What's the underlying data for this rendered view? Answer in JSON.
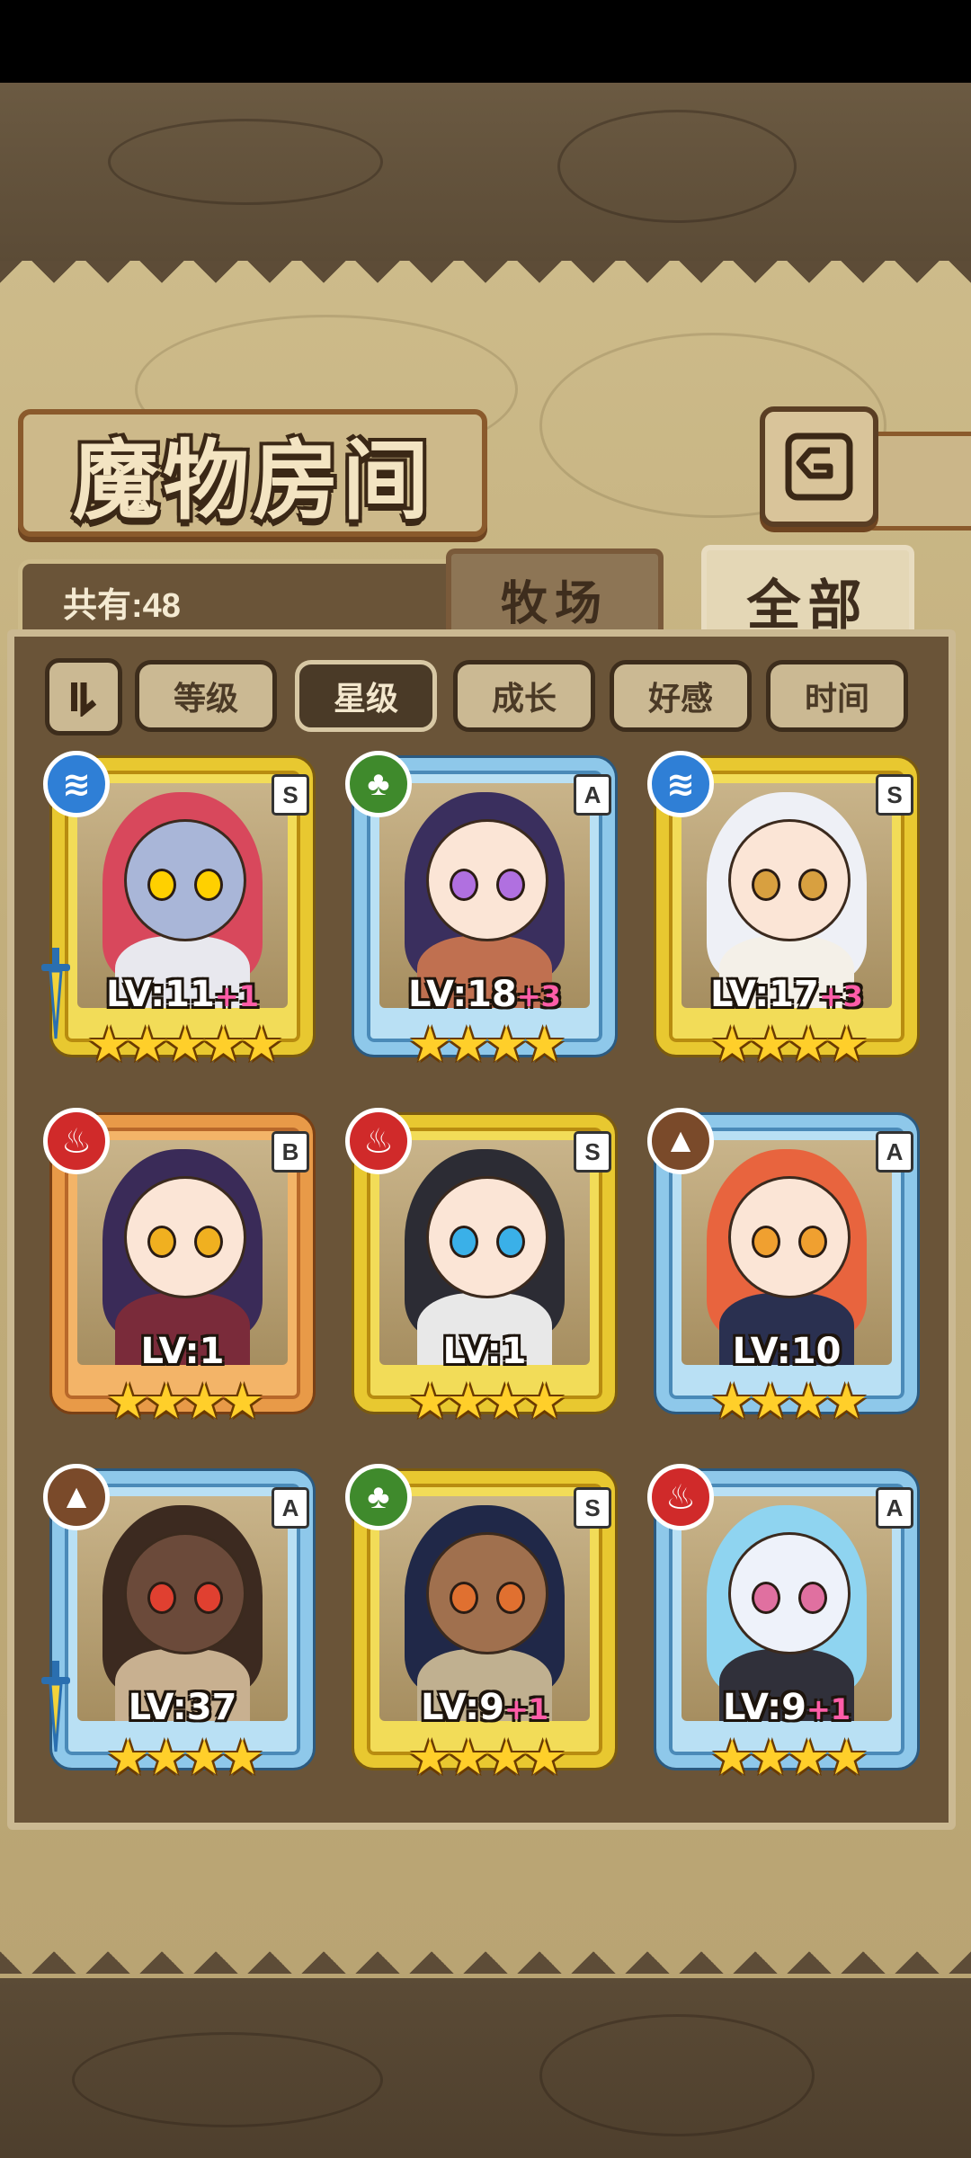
{
  "title": "魔物房间",
  "count_label": "共有:48",
  "tabs": {
    "ranch": "牧场",
    "all": "全部"
  },
  "sort_buttons": [
    "等级",
    "星级",
    "成长",
    "好感",
    "时间"
  ],
  "active_sort": "星级",
  "colors": {
    "element_water": "#2f7fd6",
    "element_wood": "#3f8a2c",
    "element_fire": "#d02a2a",
    "element_earth": "#7a4a2a",
    "bonus_text": "#ff5da8",
    "star": "#ffcf2a"
  },
  "monsters": [
    {
      "element": "water-icon",
      "rank": "S",
      "level": "LV:11",
      "bonus": "+1",
      "stars": "★★★★★",
      "frame": "gold",
      "weapon": true
    },
    {
      "element": "wood-icon",
      "rank": "A",
      "level": "LV:18",
      "bonus": "+3",
      "stars": "★★★★",
      "frame": "blue",
      "weapon": false
    },
    {
      "element": "water-icon",
      "rank": "S",
      "level": "LV:17",
      "bonus": "+3",
      "stars": "★★★★",
      "frame": "gold",
      "weapon": false
    },
    {
      "element": "fire-icon",
      "rank": "B",
      "level": "LV:1",
      "bonus": "",
      "stars": "★★★★",
      "frame": "orange",
      "weapon": false
    },
    {
      "element": "fire-icon",
      "rank": "S",
      "level": "LV:1",
      "bonus": "",
      "stars": "★★★★",
      "frame": "gold",
      "weapon": false
    },
    {
      "element": "earth-icon",
      "rank": "A",
      "level": "LV:10",
      "bonus": "",
      "stars": "★★★★",
      "frame": "blue",
      "weapon": false
    },
    {
      "element": "earth-icon",
      "rank": "A",
      "level": "LV:37",
      "bonus": "",
      "stars": "★★★★",
      "frame": "blue",
      "weapon": true
    },
    {
      "element": "wood-icon",
      "rank": "S",
      "level": "LV:9",
      "bonus": "+1",
      "stars": "★★★★",
      "frame": "gold",
      "weapon": false
    },
    {
      "element": "fire-icon",
      "rank": "A",
      "level": "LV:9",
      "bonus": "+1",
      "stars": "★★★★",
      "frame": "blue",
      "weapon": false
    }
  ]
}
